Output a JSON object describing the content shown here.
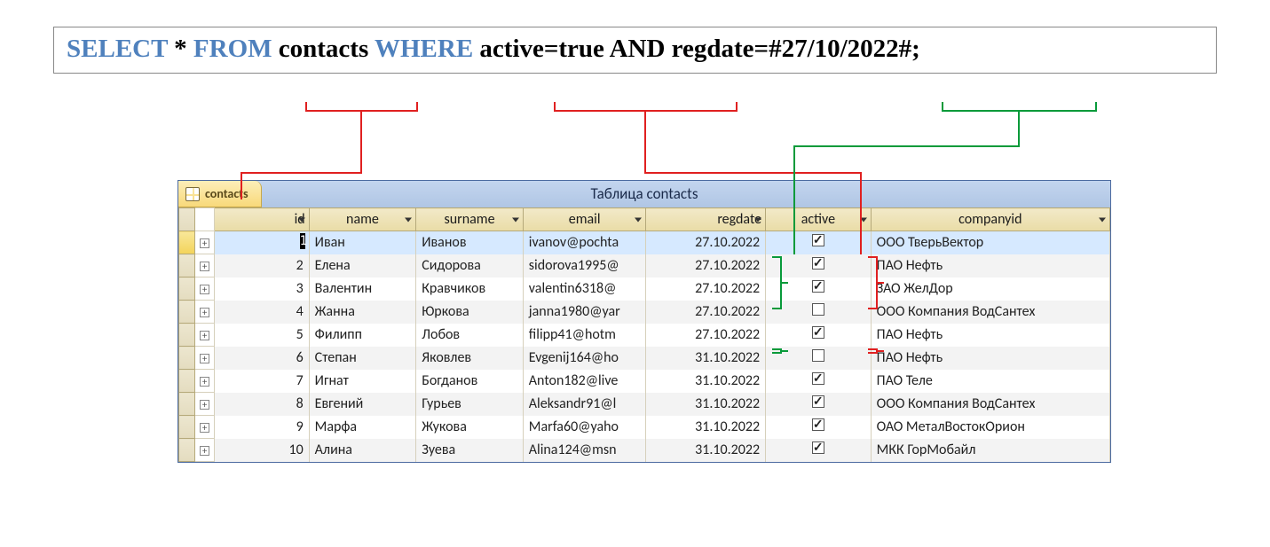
{
  "sql": {
    "select": "SELECT",
    "star": "*",
    "from": "FROM",
    "table": "contacts",
    "where": "WHERE",
    "rest": "active=true AND regdate=#27/10/2022#;"
  },
  "datasheet": {
    "tab_label": "contacts",
    "title": "Таблица contacts",
    "columns": [
      "id",
      "name",
      "surname",
      "email",
      "regdate",
      "active",
      "companyid"
    ],
    "rows": [
      {
        "id": "1",
        "name": "Иван",
        "surname": "Иванов",
        "email": "ivanov@pochta",
        "regdate": "27.10.2022",
        "active": true,
        "companyid": "ООО ТверьВектор",
        "selected": true
      },
      {
        "id": "2",
        "name": "Елена",
        "surname": "Сидорова",
        "email": "sidorova1995@",
        "regdate": "27.10.2022",
        "active": true,
        "companyid": "ПАО Нефть"
      },
      {
        "id": "3",
        "name": "Валентин",
        "surname": "Кравчиков",
        "email": "valentin6318@",
        "regdate": "27.10.2022",
        "active": true,
        "companyid": "ЗАО ЖелДор"
      },
      {
        "id": "4",
        "name": "Жанна",
        "surname": "Юркова",
        "email": "janna1980@yar",
        "regdate": "27.10.2022",
        "active": false,
        "companyid": "ООО Компания ВодСантех"
      },
      {
        "id": "5",
        "name": "Филипп",
        "surname": "Лобов",
        "email": "filipp41@hotm",
        "regdate": "27.10.2022",
        "active": true,
        "companyid": "ПАО Нефть"
      },
      {
        "id": "6",
        "name": "Степан",
        "surname": "Яковлев",
        "email": "Evgenij164@ho",
        "regdate": "31.10.2022",
        "active": false,
        "companyid": "ПАО Нефть"
      },
      {
        "id": "7",
        "name": "Игнат",
        "surname": "Богданов",
        "email": "Anton182@live",
        "regdate": "31.10.2022",
        "active": true,
        "companyid": "ПАО Теле"
      },
      {
        "id": "8",
        "name": "Евгений",
        "surname": "Гурьев",
        "email": "Aleksandr91@l",
        "regdate": "31.10.2022",
        "active": true,
        "companyid": "ООО Компания ВодСантех"
      },
      {
        "id": "9",
        "name": "Марфа",
        "surname": "Жукова",
        "email": "Marfa60@yaho",
        "regdate": "31.10.2022",
        "active": true,
        "companyid": "ОАО МеталВостокОрион"
      },
      {
        "id": "10",
        "name": "Алина",
        "surname": "Зуева",
        "email": "Alina124@msn",
        "regdate": "31.10.2022",
        "active": true,
        "companyid": "МКК ГорМобайл"
      }
    ]
  }
}
